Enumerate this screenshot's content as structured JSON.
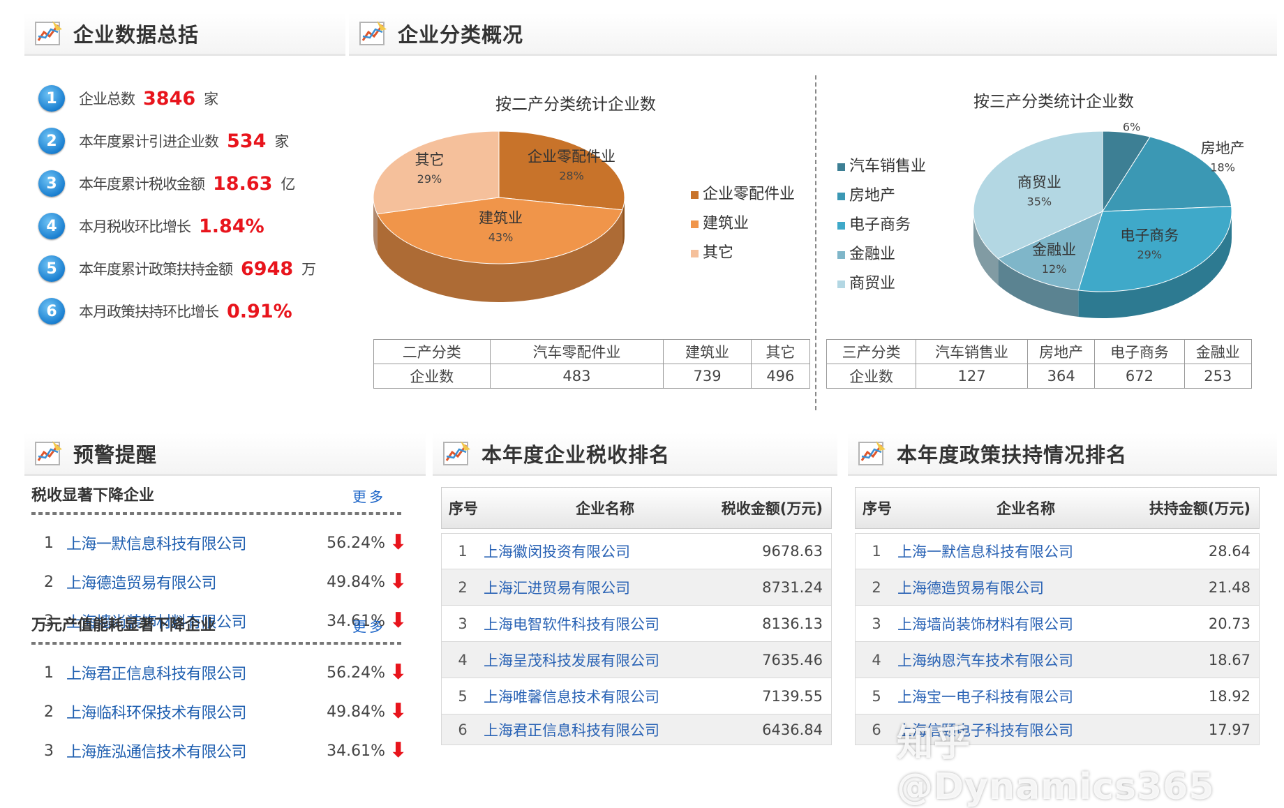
{
  "summary": {
    "title": "企业数据总括",
    "items": [
      {
        "no": "1",
        "label": "企业总数",
        "value": "3846",
        "unit": "家"
      },
      {
        "no": "2",
        "label": "本年度累计引进企业数",
        "value": "534",
        "unit": "家"
      },
      {
        "no": "3",
        "label": "本年度累计税收金额",
        "value": "18.63",
        "unit": "亿"
      },
      {
        "no": "4",
        "label": "本月税收环比增长",
        "value": "1.84%",
        "unit": ""
      },
      {
        "no": "5",
        "label": "本年度累计政策扶持金额",
        "value": "6948",
        "unit": "万"
      },
      {
        "no": "6",
        "label": "本月政策扶持环比增长",
        "value": "0.91%",
        "unit": ""
      }
    ]
  },
  "classification": {
    "title": "企业分类概况",
    "table2": {
      "header": [
        "二产分类",
        "汽车零配件业",
        "建筑业",
        "其它"
      ],
      "row": [
        "企业数",
        "483",
        "739",
        "496"
      ]
    },
    "table3": {
      "header": [
        "三产分类",
        "汽车销售业",
        "房地产",
        "电子商务",
        "金融业"
      ],
      "row": [
        "企业数",
        "127",
        "364",
        "672",
        "253"
      ]
    }
  },
  "chart_data": [
    {
      "type": "pie",
      "title": "按二产分类统计企业数",
      "categories": [
        "企业零配件业",
        "建筑业",
        "其它"
      ],
      "values": [
        28,
        43,
        29
      ],
      "labels": [
        "企业零配件业",
        "建筑业",
        "其它"
      ],
      "pct_labels": [
        "28%",
        "43%",
        "29%"
      ],
      "colors": [
        "#c8732a",
        "#f0954a",
        "#f5c09b"
      ],
      "legend": [
        "企业零配件业",
        "建筑业",
        "其它"
      ],
      "legend_placement": "right"
    },
    {
      "type": "pie",
      "title": "按三产分类统计企业数",
      "categories": [
        "汽车销售业",
        "房地产",
        "电子商务",
        "金融业",
        "商贸业"
      ],
      "values": [
        6,
        18,
        29,
        12,
        35
      ],
      "labels": [
        "汽车销售业",
        "房地产",
        "电子商务",
        "金融业",
        "商贸业"
      ],
      "pct_labels": [
        "6%",
        "18%",
        "29%",
        "12%",
        "35%"
      ],
      "colors": [
        "#3d7f94",
        "#3b98b4",
        "#3fa9c9",
        "#7fb6c9",
        "#b3d7e3"
      ],
      "legend": [
        "汽车销售业",
        "房地产",
        "电子商务",
        "金融业",
        "商贸业"
      ],
      "legend_placement": "left"
    }
  ],
  "warning": {
    "title": "预警提醒",
    "more": "更多",
    "sections": [
      {
        "title": "税收显著下降企业",
        "rows": [
          {
            "no": "1",
            "company": "上海一默信息科技有限公司",
            "pct": "56.24%"
          },
          {
            "no": "2",
            "company": "上海德造贸易有限公司",
            "pct": "49.84%"
          },
          {
            "no": "3",
            "company": "上海墙尚装饰材料有限公司",
            "pct": "34.61%"
          }
        ]
      },
      {
        "title": "万元产值能耗显著下降企业",
        "rows": [
          {
            "no": "1",
            "company": "上海君正信息科技有限公司",
            "pct": "56.24%"
          },
          {
            "no": "2",
            "company": "上海临科环保技术有限公司",
            "pct": "49.84%"
          },
          {
            "no": "3",
            "company": "上海旌泓通信技术有限公司",
            "pct": "34.61%"
          }
        ]
      }
    ]
  },
  "tax_rank": {
    "title": "本年度企业税收排名",
    "cols": [
      "序号",
      "企业名称",
      "税收金额(万元)"
    ],
    "rows": [
      {
        "no": "1",
        "company": "上海徽闵投资有限公司",
        "value": "9678.63"
      },
      {
        "no": "2",
        "company": "上海汇进贸易有限公司",
        "value": "8731.24"
      },
      {
        "no": "3",
        "company": "上海电智软件科技有限公司",
        "value": "8136.13"
      },
      {
        "no": "4",
        "company": "上海呈茂科技发展有限公司",
        "value": "7635.46"
      },
      {
        "no": "5",
        "company": "上海唯馨信息技术有限公司",
        "value": "7139.55"
      },
      {
        "no": "6",
        "company": "上海君正信息科技有限公司",
        "value": "6436.84"
      }
    ]
  },
  "policy_rank": {
    "title": "本年度政策扶持情况排名",
    "cols": [
      "序号",
      "企业名称",
      "扶持金额(万元)"
    ],
    "rows": [
      {
        "no": "1",
        "company": "上海一默信息科技有限公司",
        "value": "28.64"
      },
      {
        "no": "2",
        "company": "上海德造贸易有限公司",
        "value": "21.48"
      },
      {
        "no": "3",
        "company": "上海墙尚装饰材料有限公司",
        "value": "20.73"
      },
      {
        "no": "4",
        "company": "上海纳恩汽车技术有限公司",
        "value": "18.67"
      },
      {
        "no": "5",
        "company": "上海宝一电子科技有限公司",
        "value": "18.92"
      },
      {
        "no": "6",
        "company": "上海信颐电子科技有限公司",
        "value": "17.97"
      }
    ]
  },
  "watermark": "知乎 @Dynamics365"
}
